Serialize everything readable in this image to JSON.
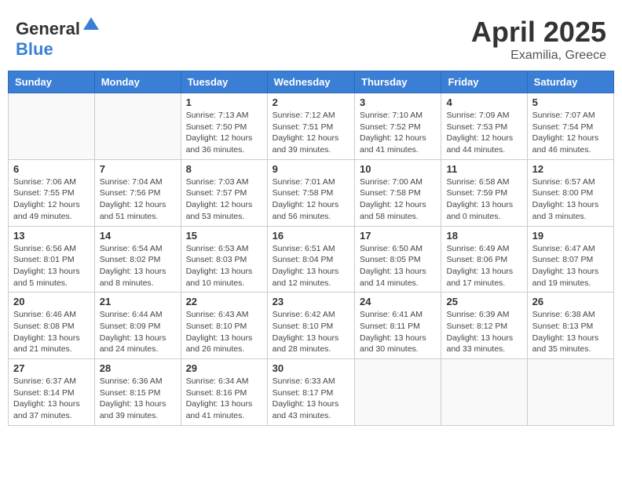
{
  "header": {
    "logo_general": "General",
    "logo_blue": "Blue",
    "month_year": "April 2025",
    "location": "Examilia, Greece"
  },
  "weekdays": [
    "Sunday",
    "Monday",
    "Tuesday",
    "Wednesday",
    "Thursday",
    "Friday",
    "Saturday"
  ],
  "weeks": [
    [
      {
        "day": "",
        "info": ""
      },
      {
        "day": "",
        "info": ""
      },
      {
        "day": "1",
        "info": "Sunrise: 7:13 AM\nSunset: 7:50 PM\nDaylight: 12 hours and 36 minutes."
      },
      {
        "day": "2",
        "info": "Sunrise: 7:12 AM\nSunset: 7:51 PM\nDaylight: 12 hours and 39 minutes."
      },
      {
        "day": "3",
        "info": "Sunrise: 7:10 AM\nSunset: 7:52 PM\nDaylight: 12 hours and 41 minutes."
      },
      {
        "day": "4",
        "info": "Sunrise: 7:09 AM\nSunset: 7:53 PM\nDaylight: 12 hours and 44 minutes."
      },
      {
        "day": "5",
        "info": "Sunrise: 7:07 AM\nSunset: 7:54 PM\nDaylight: 12 hours and 46 minutes."
      }
    ],
    [
      {
        "day": "6",
        "info": "Sunrise: 7:06 AM\nSunset: 7:55 PM\nDaylight: 12 hours and 49 minutes."
      },
      {
        "day": "7",
        "info": "Sunrise: 7:04 AM\nSunset: 7:56 PM\nDaylight: 12 hours and 51 minutes."
      },
      {
        "day": "8",
        "info": "Sunrise: 7:03 AM\nSunset: 7:57 PM\nDaylight: 12 hours and 53 minutes."
      },
      {
        "day": "9",
        "info": "Sunrise: 7:01 AM\nSunset: 7:58 PM\nDaylight: 12 hours and 56 minutes."
      },
      {
        "day": "10",
        "info": "Sunrise: 7:00 AM\nSunset: 7:58 PM\nDaylight: 12 hours and 58 minutes."
      },
      {
        "day": "11",
        "info": "Sunrise: 6:58 AM\nSunset: 7:59 PM\nDaylight: 13 hours and 0 minutes."
      },
      {
        "day": "12",
        "info": "Sunrise: 6:57 AM\nSunset: 8:00 PM\nDaylight: 13 hours and 3 minutes."
      }
    ],
    [
      {
        "day": "13",
        "info": "Sunrise: 6:56 AM\nSunset: 8:01 PM\nDaylight: 13 hours and 5 minutes."
      },
      {
        "day": "14",
        "info": "Sunrise: 6:54 AM\nSunset: 8:02 PM\nDaylight: 13 hours and 8 minutes."
      },
      {
        "day": "15",
        "info": "Sunrise: 6:53 AM\nSunset: 8:03 PM\nDaylight: 13 hours and 10 minutes."
      },
      {
        "day": "16",
        "info": "Sunrise: 6:51 AM\nSunset: 8:04 PM\nDaylight: 13 hours and 12 minutes."
      },
      {
        "day": "17",
        "info": "Sunrise: 6:50 AM\nSunset: 8:05 PM\nDaylight: 13 hours and 14 minutes."
      },
      {
        "day": "18",
        "info": "Sunrise: 6:49 AM\nSunset: 8:06 PM\nDaylight: 13 hours and 17 minutes."
      },
      {
        "day": "19",
        "info": "Sunrise: 6:47 AM\nSunset: 8:07 PM\nDaylight: 13 hours and 19 minutes."
      }
    ],
    [
      {
        "day": "20",
        "info": "Sunrise: 6:46 AM\nSunset: 8:08 PM\nDaylight: 13 hours and 21 minutes."
      },
      {
        "day": "21",
        "info": "Sunrise: 6:44 AM\nSunset: 8:09 PM\nDaylight: 13 hours and 24 minutes."
      },
      {
        "day": "22",
        "info": "Sunrise: 6:43 AM\nSunset: 8:10 PM\nDaylight: 13 hours and 26 minutes."
      },
      {
        "day": "23",
        "info": "Sunrise: 6:42 AM\nSunset: 8:10 PM\nDaylight: 13 hours and 28 minutes."
      },
      {
        "day": "24",
        "info": "Sunrise: 6:41 AM\nSunset: 8:11 PM\nDaylight: 13 hours and 30 minutes."
      },
      {
        "day": "25",
        "info": "Sunrise: 6:39 AM\nSunset: 8:12 PM\nDaylight: 13 hours and 33 minutes."
      },
      {
        "day": "26",
        "info": "Sunrise: 6:38 AM\nSunset: 8:13 PM\nDaylight: 13 hours and 35 minutes."
      }
    ],
    [
      {
        "day": "27",
        "info": "Sunrise: 6:37 AM\nSunset: 8:14 PM\nDaylight: 13 hours and 37 minutes."
      },
      {
        "day": "28",
        "info": "Sunrise: 6:36 AM\nSunset: 8:15 PM\nDaylight: 13 hours and 39 minutes."
      },
      {
        "day": "29",
        "info": "Sunrise: 6:34 AM\nSunset: 8:16 PM\nDaylight: 13 hours and 41 minutes."
      },
      {
        "day": "30",
        "info": "Sunrise: 6:33 AM\nSunset: 8:17 PM\nDaylight: 13 hours and 43 minutes."
      },
      {
        "day": "",
        "info": ""
      },
      {
        "day": "",
        "info": ""
      },
      {
        "day": "",
        "info": ""
      }
    ]
  ]
}
